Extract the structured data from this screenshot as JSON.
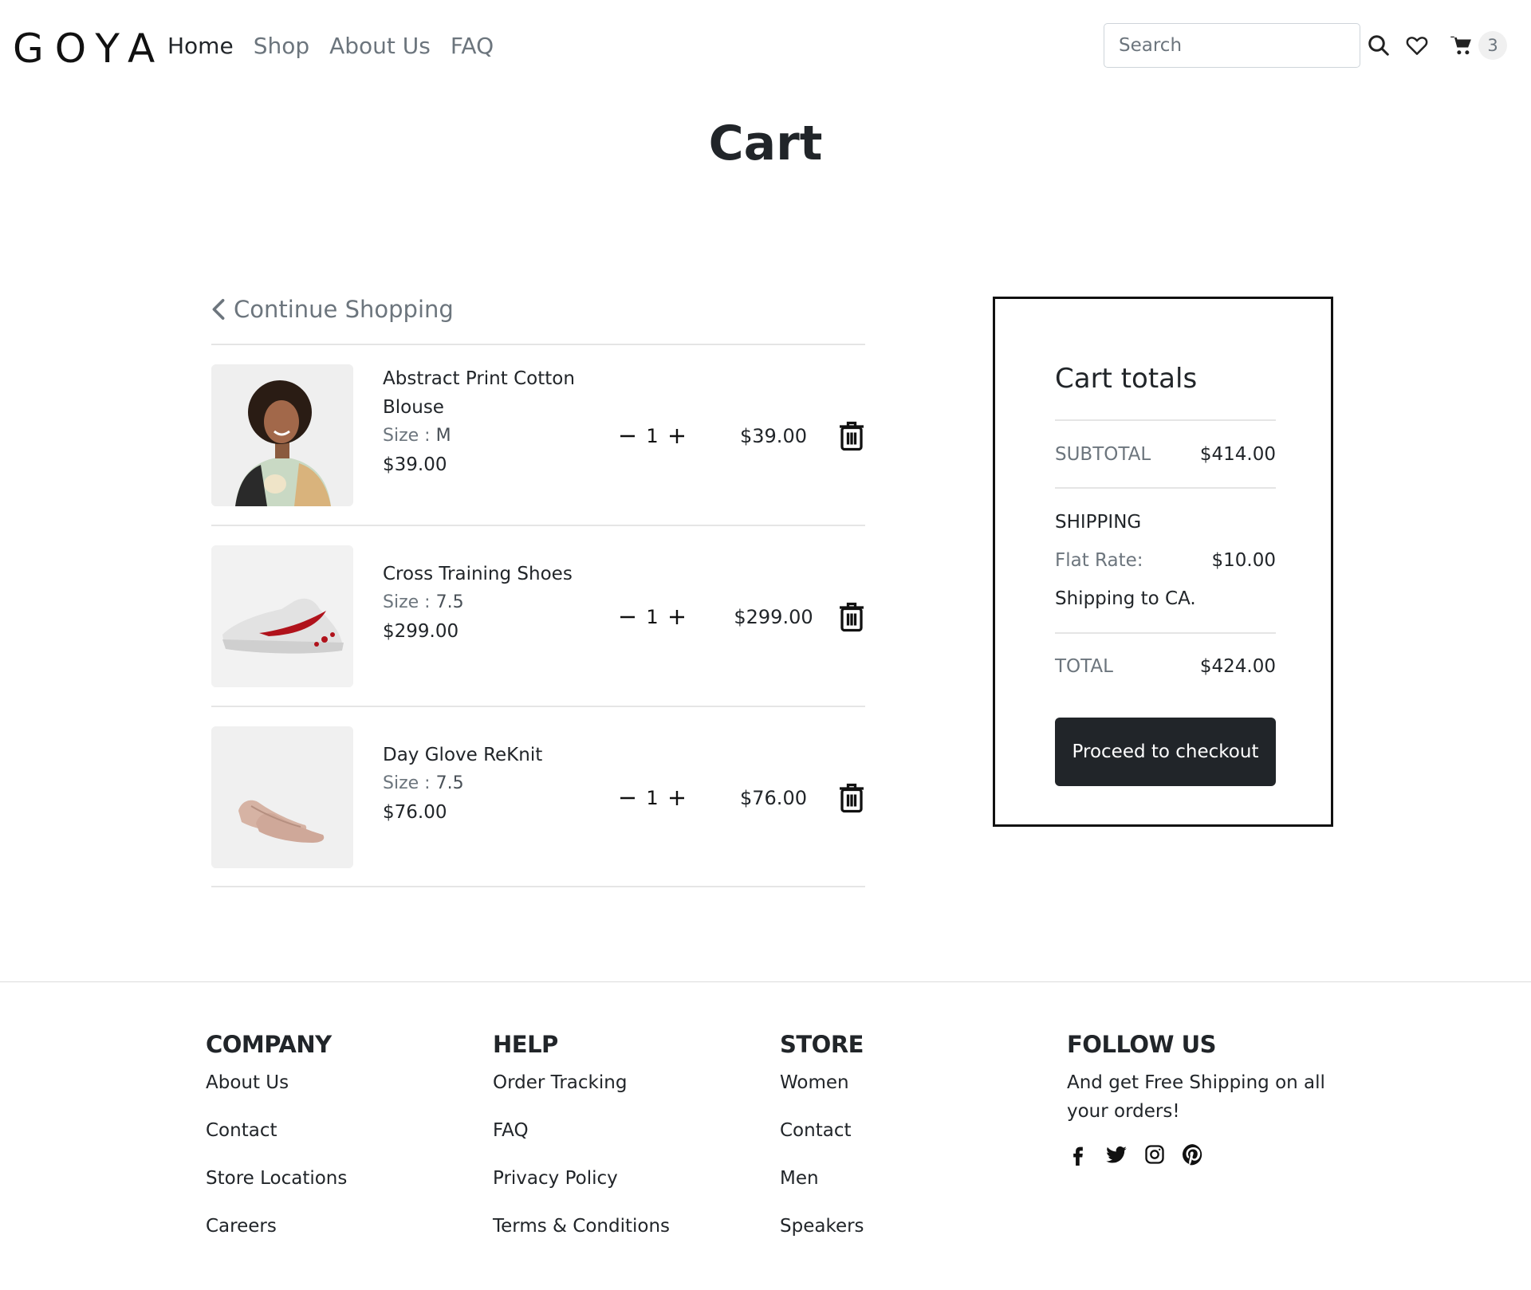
{
  "brand": {
    "logo": "GOYA"
  },
  "nav": {
    "items": [
      "Home",
      "Shop",
      "About Us",
      "FAQ"
    ]
  },
  "search": {
    "placeholder": "Search"
  },
  "cart": {
    "count": "3"
  },
  "page": {
    "title": "Cart"
  },
  "continue_label": "Continue Shopping",
  "items": [
    {
      "name": "Abstract Print Cotton Blouse",
      "size_label": "Size :",
      "size": "M",
      "unit_price": "$39.00",
      "qty": "1",
      "line_total": "$39.00"
    },
    {
      "name": "Cross Training Shoes",
      "size_label": "Size :",
      "size": "7.5",
      "unit_price": "$299.00",
      "qty": "1",
      "line_total": "$299.00"
    },
    {
      "name": "Day Glove ReKnit",
      "size_label": "Size :",
      "size": "7.5",
      "unit_price": "$76.00",
      "qty": "1",
      "line_total": "$76.00"
    }
  ],
  "totals": {
    "title": "Cart totals",
    "subtotal_label": "SUBTOTAL",
    "subtotal": "$414.00",
    "shipping_label": "SHIPPING",
    "flat_rate_label": "Flat Rate:",
    "flat_rate": "$10.00",
    "shipping_to": "Shipping to CA.",
    "total_label": "TOTAL",
    "total": "$424.00",
    "checkout_label": "Proceed to checkout"
  },
  "footer": {
    "company": {
      "title": "COMPANY",
      "links": [
        "About Us",
        "Contact",
        "Store Locations",
        "Careers"
      ]
    },
    "help": {
      "title": "HELP",
      "links": [
        "Order Tracking",
        "FAQ",
        "Privacy Policy",
        "Terms & Conditions"
      ]
    },
    "store": {
      "title": "STORE",
      "links": [
        "Women",
        "Contact",
        "Men",
        "Speakers"
      ]
    },
    "follow": {
      "title": "FOLLOW US",
      "text": "And get Free Shipping on all your orders!"
    }
  },
  "icons": {
    "search": "search-icon",
    "wishlist": "heart-icon",
    "cart": "cart-icon",
    "back": "chevron-left-icon",
    "minus": "minus-icon",
    "plus": "plus-icon",
    "delete": "trash-icon",
    "social": [
      "facebook-icon",
      "twitter-icon",
      "instagram-icon",
      "pinterest-icon"
    ]
  },
  "colors": {
    "primary_dark": "#212529",
    "muted": "#6c757d",
    "badge_bg": "#f0f0f0"
  }
}
